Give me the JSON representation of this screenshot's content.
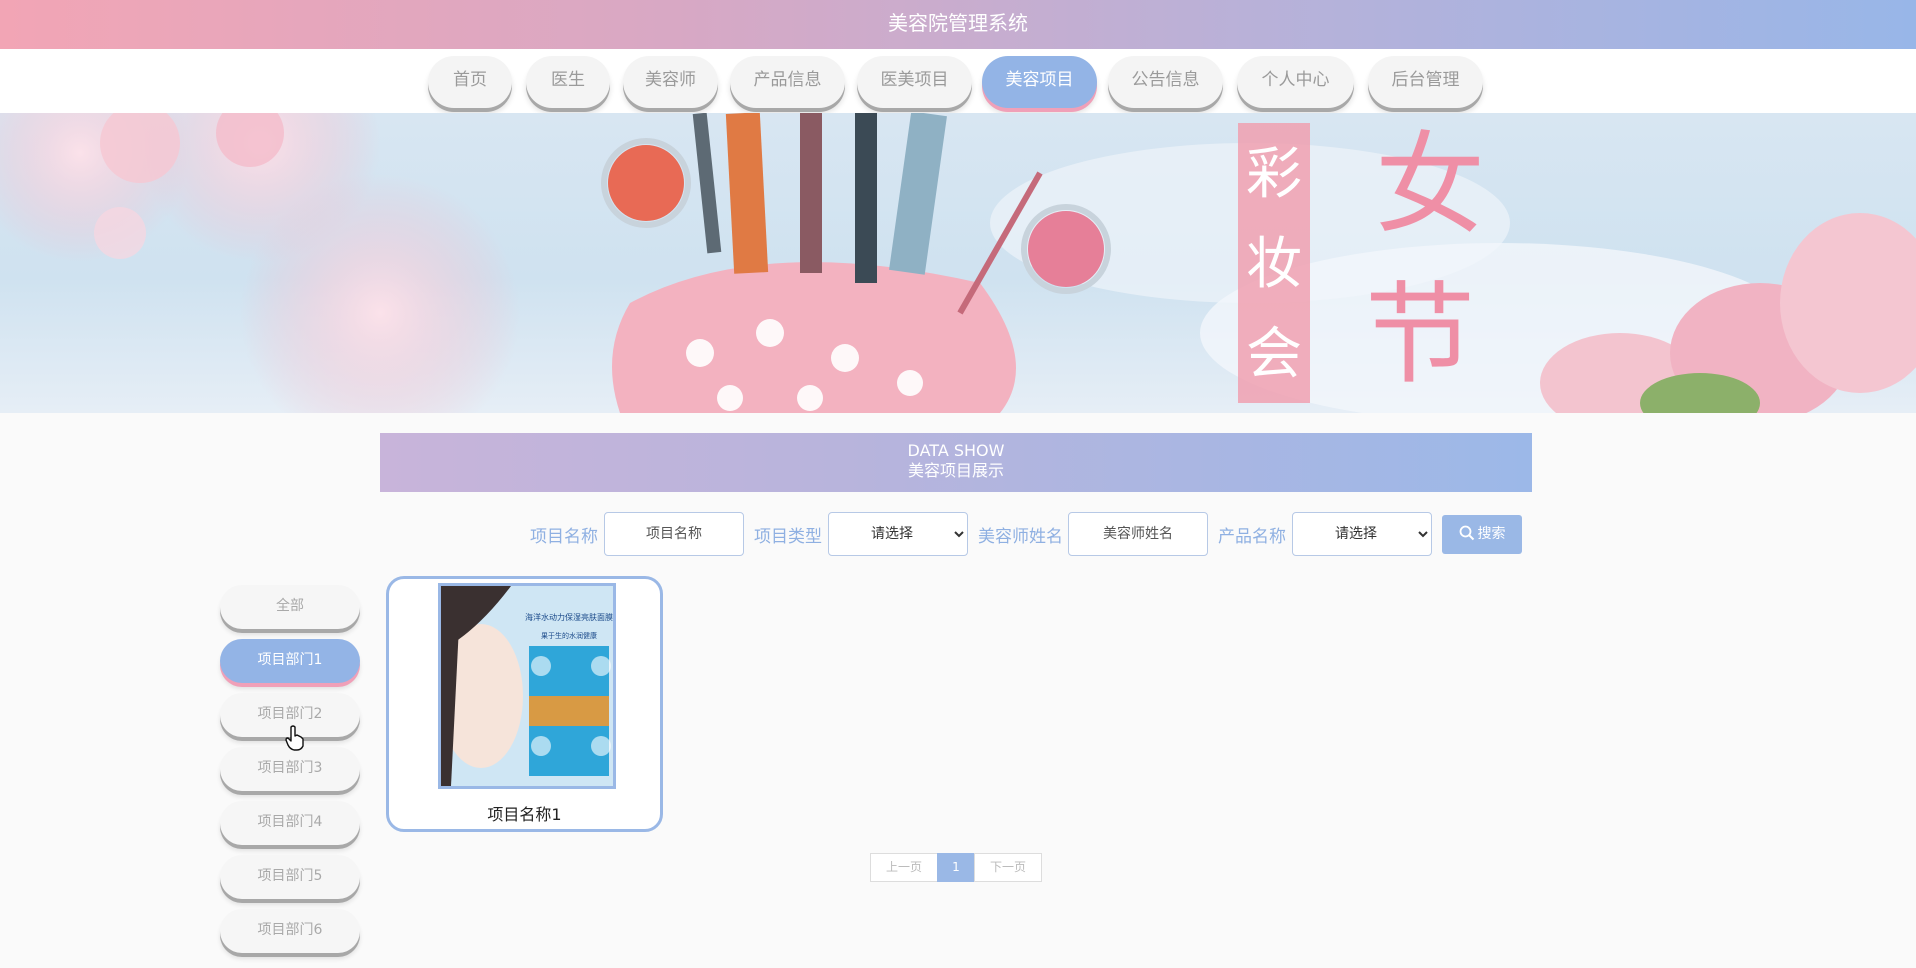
{
  "header": {
    "title": "美容院管理系统"
  },
  "nav": {
    "items": [
      {
        "label": "首页"
      },
      {
        "label": "医生"
      },
      {
        "label": "美容师"
      },
      {
        "label": "产品信息"
      },
      {
        "label": "医美项目"
      },
      {
        "label": "美容项目",
        "active": true
      },
      {
        "label": "公告信息"
      },
      {
        "label": "个人中心"
      },
      {
        "label": "后台管理"
      }
    ]
  },
  "banner": {
    "decor_text": [
      "彩",
      "妆",
      "会",
      "女",
      "节"
    ],
    "colors": {
      "sky": "#cfe2f0",
      "pink": "#f0a0b0",
      "blossom": "#f6c7d2"
    }
  },
  "section": {
    "title_en": "DATA SHOW",
    "title_cn": "美容项目展示"
  },
  "search": {
    "name_label": "项目名称",
    "name_placeholder": "项目名称",
    "type_label": "项目类型",
    "type_value": "请选择",
    "beautician_label": "美容师姓名",
    "beautician_placeholder": "美容师姓名",
    "product_label": "产品名称",
    "product_value": "请选择",
    "button_label": "搜索",
    "button_icon": "search-icon"
  },
  "categories": [
    {
      "label": "全部"
    },
    {
      "label": "项目部门1",
      "active": true
    },
    {
      "label": "项目部门2"
    },
    {
      "label": "项目部门3"
    },
    {
      "label": "项目部门4"
    },
    {
      "label": "项目部门5"
    },
    {
      "label": "项目部门6"
    }
  ],
  "items": [
    {
      "name": "项目名称1",
      "image_text": [
        "海洋水动力保湿亮肤面膜",
        "果于生的水润健康"
      ]
    }
  ],
  "pagination": {
    "prev": "上一页",
    "current": "1",
    "next": "下一页"
  },
  "theme": {
    "accent": "#9ab8e6",
    "pink": "#f0a0b8",
    "label": "#8fb0e2"
  }
}
